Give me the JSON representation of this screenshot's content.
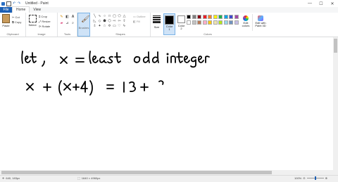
{
  "window": {
    "title": "Untitled - Paint",
    "min": "—",
    "max": "☐",
    "close": "✕"
  },
  "tabs": {
    "file": "File",
    "home": "Home",
    "view": "View"
  },
  "ribbon": {
    "clipboard": {
      "label": "Clipboard",
      "paste": "Paste",
      "cut": "Cut",
      "copy": "Copy"
    },
    "image": {
      "label": "Image",
      "select": "Select",
      "crop": "Crop",
      "resize": "Resize",
      "rotate": "Rotate"
    },
    "tools": {
      "label": "Tools"
    },
    "brushes": {
      "label": "Brushes"
    },
    "shapes": {
      "label": "Shapes",
      "outline": "Outline",
      "fill": "Fill"
    },
    "size": {
      "label": "Size"
    },
    "color1": {
      "label": "Color 1",
      "color": "#000000"
    },
    "color2": {
      "label": "Color 2",
      "color": "#ffffff"
    },
    "colors": {
      "label": "Colors",
      "palette_row1": [
        "#000000",
        "#7f7f7f",
        "#880015",
        "#ed1c24",
        "#ff7f27",
        "#fff200",
        "#22b14c",
        "#00a2e8",
        "#3f48cc",
        "#a349a4"
      ],
      "palette_row2": [
        "#ffffff",
        "#c3c3c3",
        "#b97a57",
        "#ffaec9",
        "#ffc90e",
        "#efe4b0",
        "#b5e61d",
        "#99d9ea",
        "#7092be",
        "#c8bfe7"
      ]
    },
    "edit_colors": "Edit colors",
    "edit_paint3d": "Edit with Paint 3D"
  },
  "status": {
    "cursor": "640, 183px",
    "dimensions": "1640 × 4960px",
    "zoom": "100%"
  }
}
